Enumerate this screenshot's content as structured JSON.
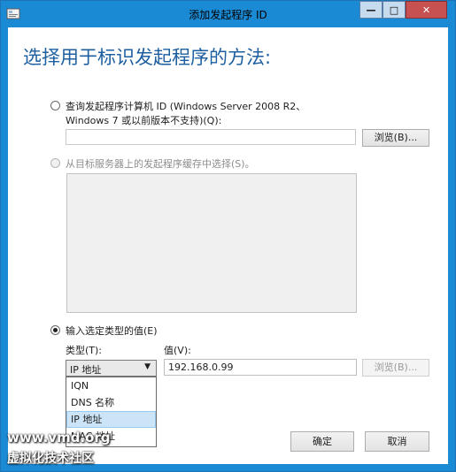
{
  "window": {
    "title": "添加发起程序 ID",
    "controls": {
      "minimize": "—",
      "maximize": "□",
      "close": "✕"
    }
  },
  "heading": "选择用于标识发起程序的方法:",
  "option_query": {
    "label_line1": "查询发起程序计算机 ID (Windows Server 2008 R2、",
    "label_line2": "Windows 7 或以前版本不支持)(Q):",
    "input_value": "",
    "browse_label": "浏览(B)...",
    "selected": false
  },
  "option_cache": {
    "label": "从目标服务器上的发起程序缓存中选择(S)。",
    "selected": false,
    "enabled": false
  },
  "option_manual": {
    "label": "输入选定类型的值(E)",
    "selected": true,
    "type_label": "类型(T):",
    "value_label": "值(V):",
    "type_selected": "IP 地址",
    "value": "192.168.0.99",
    "browse_label": "浏览(B)...",
    "type_options": [
      "IQN",
      "DNS 名称",
      "IP 地址",
      "MAC 地址"
    ],
    "type_selected_index": 2
  },
  "buttons": {
    "ok": "确定",
    "cancel": "取消"
  },
  "watermark": {
    "line1": "www.vmd.org",
    "line2": "虚拟化技术社区"
  }
}
